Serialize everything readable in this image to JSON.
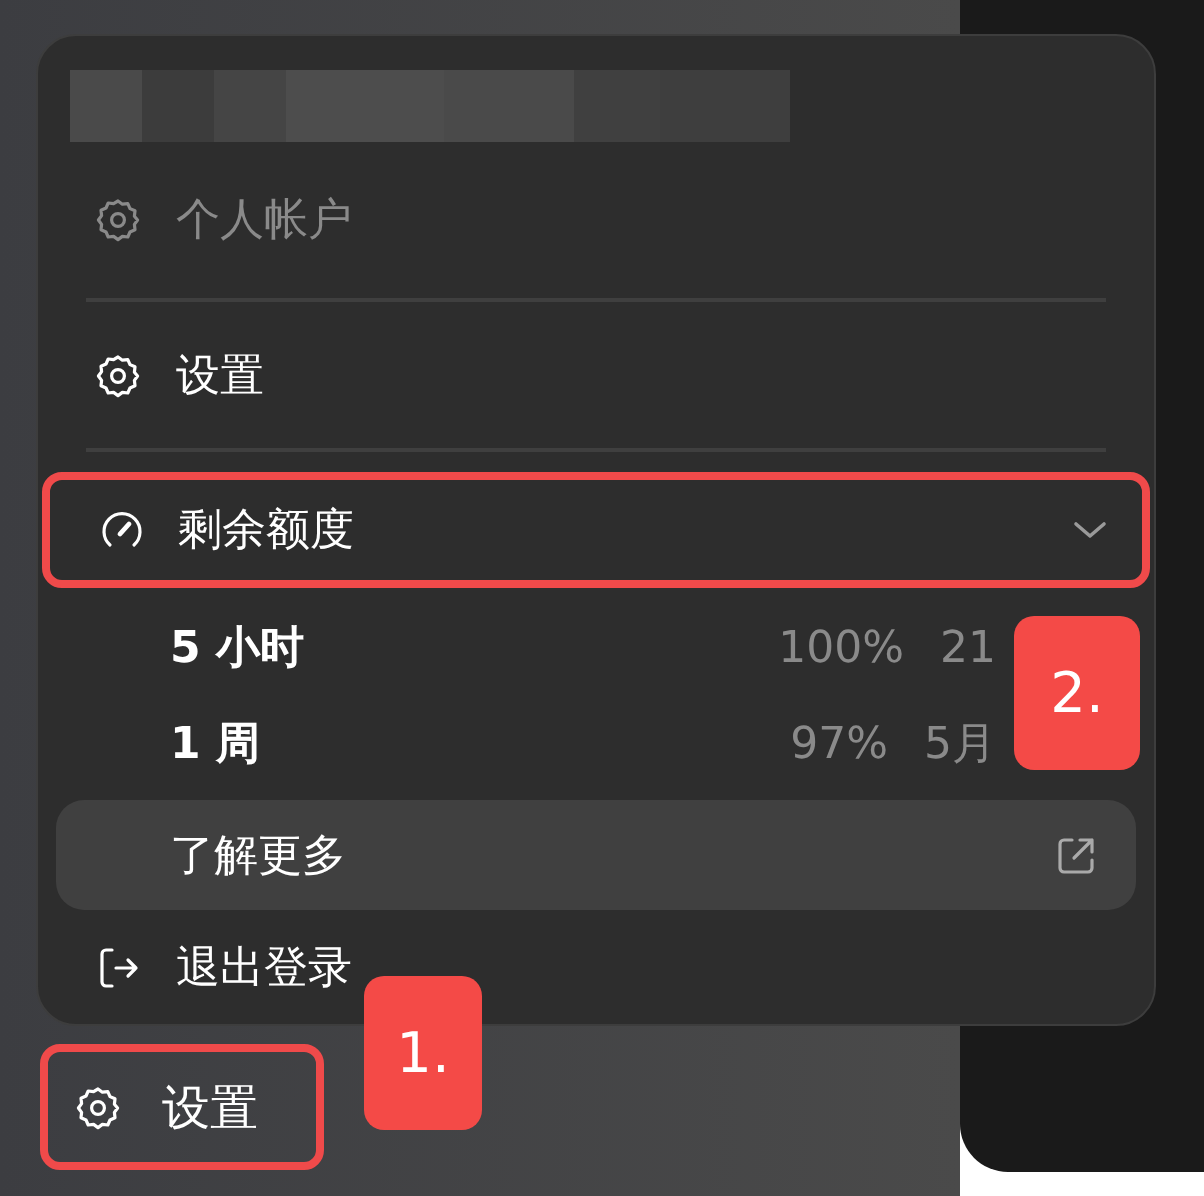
{
  "menu": {
    "account": {
      "label": "个人帐户",
      "disabled": true
    },
    "settings": {
      "label": "设置",
      "disabled": false
    },
    "usage": {
      "label": "剩余额度",
      "expanded": true,
      "highlighted": true,
      "limits": [
        {
          "label": "5 小时",
          "percent": "100%",
          "reset": "21"
        },
        {
          "label": "1 周",
          "percent": "97%",
          "reset": "5月"
        }
      ],
      "learn_more": {
        "label": "了解更多"
      }
    },
    "logout": {
      "label": "退出登录"
    }
  },
  "sidebar_settings": {
    "label": "设置",
    "highlighted": true
  },
  "callouts": [
    {
      "label": "1."
    },
    {
      "label": "2."
    }
  ]
}
